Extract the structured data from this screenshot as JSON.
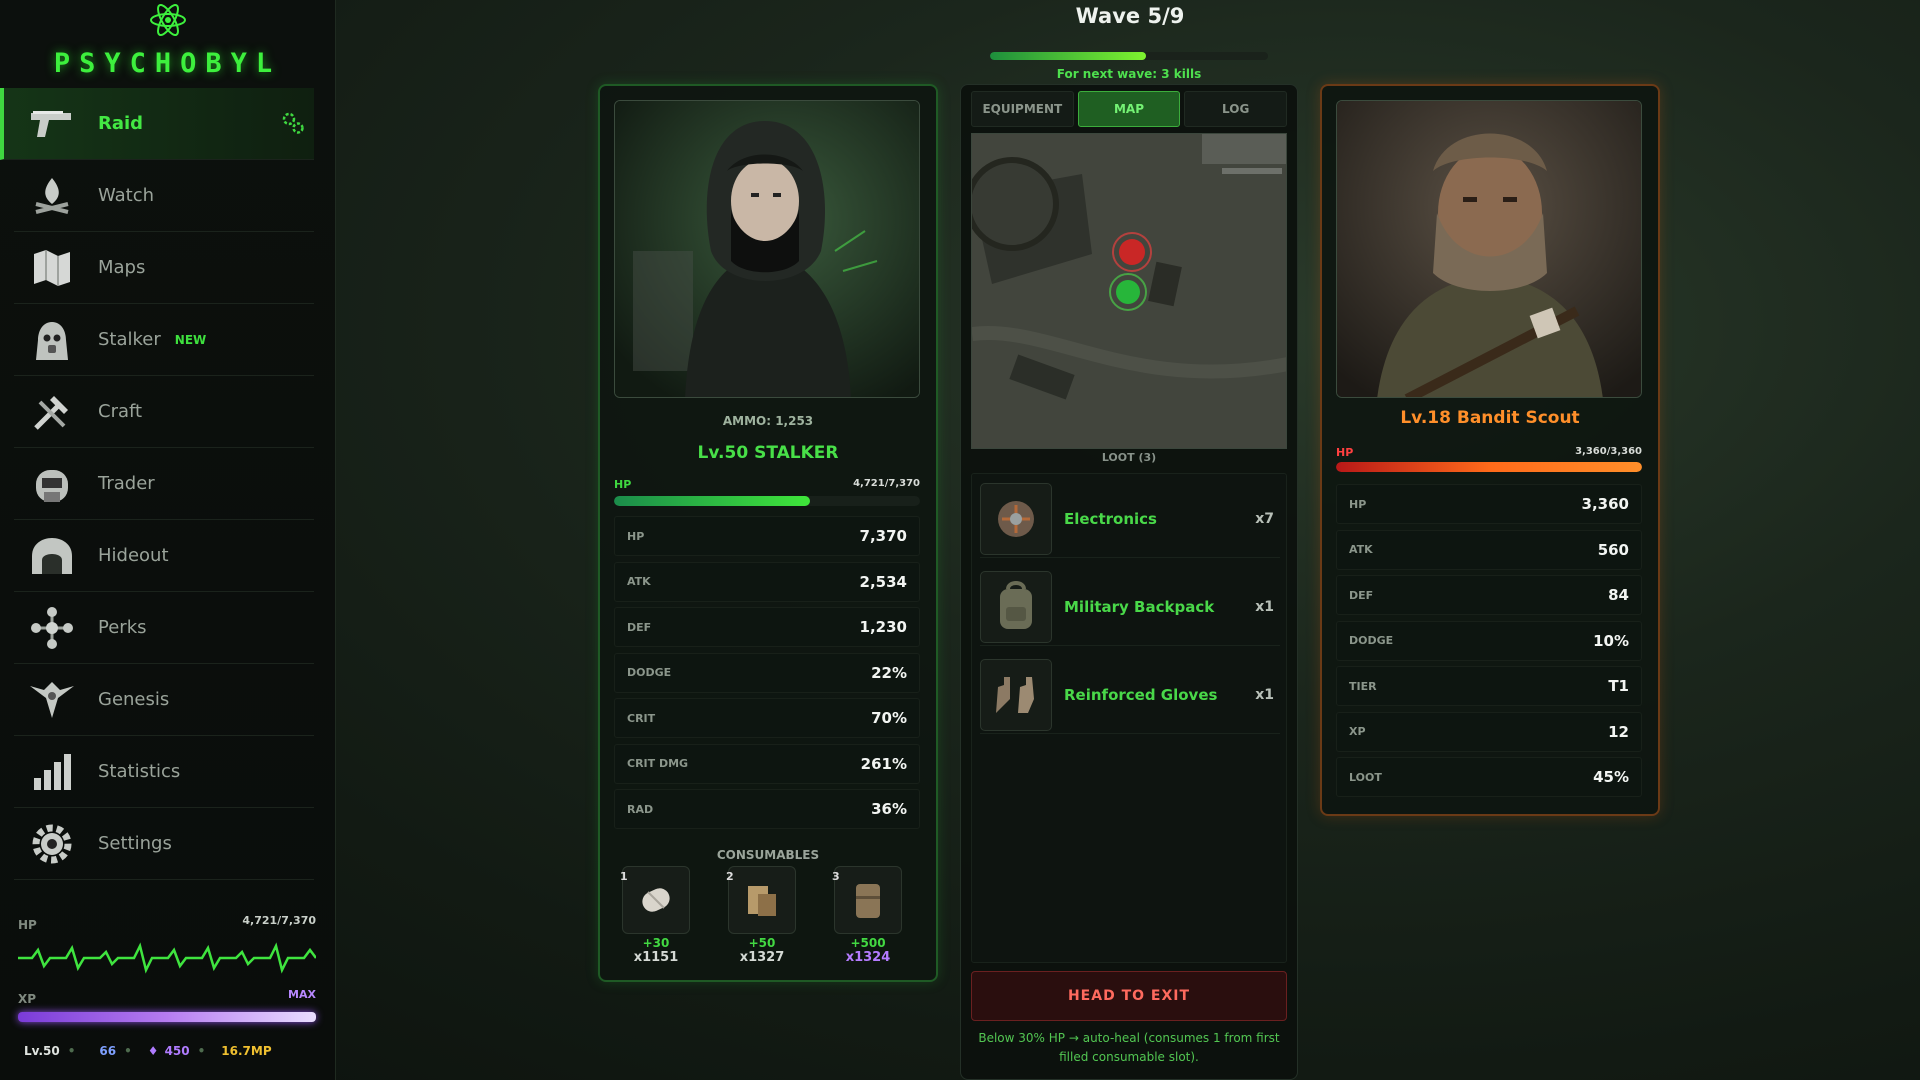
{
  "app": {
    "title": "PSYCHOBYL"
  },
  "sidebar": {
    "items": [
      {
        "label": "Raid",
        "icon": "pistol-icon",
        "active": true
      },
      {
        "label": "Watch",
        "icon": "campfire-icon"
      },
      {
        "label": "Maps",
        "icon": "map-icon"
      },
      {
        "label": "Stalker",
        "icon": "gasmask-stalker-icon",
        "badge": "NEW"
      },
      {
        "label": "Craft",
        "icon": "tools-icon"
      },
      {
        "label": "Trader",
        "icon": "trader-icon"
      },
      {
        "label": "Hideout",
        "icon": "bunker-icon"
      },
      {
        "label": "Perks",
        "icon": "perks-icon"
      },
      {
        "label": "Genesis",
        "icon": "eagle-icon"
      },
      {
        "label": "Statistics",
        "icon": "bar-chart-icon"
      },
      {
        "label": "Settings",
        "icon": "gear-icon"
      }
    ],
    "hp_label": "HP",
    "hp_value": "4,721/7,370",
    "xp_label": "XP",
    "xp_value": "MAX",
    "level": "Lv.50",
    "gold": "66",
    "crystals": "450",
    "mp": "16.7MP"
  },
  "wave": {
    "title": "Wave 5/9",
    "progress": 0.56,
    "subtitle": "For next wave: 3 kills"
  },
  "player": {
    "ammo": "AMMO: 1,253",
    "name": "Lv.50 STALKER",
    "hp_label": "HP",
    "hp_value": "4,721/7,370",
    "hp_fraction": 0.64,
    "stats": [
      {
        "k": "HP",
        "v": "7,370"
      },
      {
        "k": "ATK",
        "v": "2,534"
      },
      {
        "k": "DEF",
        "v": "1,230"
      },
      {
        "k": "DODGE",
        "v": "22%"
      },
      {
        "k": "CRIT",
        "v": "70%"
      },
      {
        "k": "CRIT DMG",
        "v": "261%"
      },
      {
        "k": "RAD",
        "v": "36%"
      }
    ],
    "consumables_title": "CONSUMABLES",
    "consumables": [
      {
        "slot": "1",
        "heal": "+30",
        "qty": "x1151",
        "icon": "bandage-icon"
      },
      {
        "slot": "2",
        "heal": "+50",
        "qty": "x1327",
        "icon": "medkit-icon"
      },
      {
        "slot": "3",
        "heal": "+500",
        "qty": "x1324",
        "icon": "med-pack-icon"
      }
    ]
  },
  "center": {
    "tabs": [
      {
        "label": "EQUIPMENT"
      },
      {
        "label": "MAP",
        "active": true
      },
      {
        "label": "LOG"
      }
    ],
    "loot_title": "LOOT (3)",
    "loot": [
      {
        "name": "Electronics",
        "qty": "x7",
        "icon": "electronics-icon"
      },
      {
        "name": "Military Backpack",
        "qty": "x1",
        "icon": "backpack-icon"
      },
      {
        "name": "Reinforced Gloves",
        "qty": "x1",
        "icon": "gloves-icon"
      }
    ],
    "exit_label": "HEAD TO EXIT",
    "note": "Below 30% HP → auto-heal (consumes 1 from first filled consumable slot)."
  },
  "enemy": {
    "name": "Lv.18 Bandit Scout",
    "hp_label": "HP",
    "hp_value": "3,360/3,360",
    "hp_fraction": 1.0,
    "stats": [
      {
        "k": "HP",
        "v": "3,360"
      },
      {
        "k": "ATK",
        "v": "560"
      },
      {
        "k": "DEF",
        "v": "84"
      },
      {
        "k": "DODGE",
        "v": "10%"
      },
      {
        "k": "TIER",
        "v": "T1"
      },
      {
        "k": "XP",
        "v": "12"
      },
      {
        "k": "LOOT",
        "v": "45%"
      }
    ]
  },
  "colors": {
    "accent": "#3fd840",
    "enemy": "#ff8f2a",
    "xp": "#a46be8",
    "danger": "#ff6a5e"
  }
}
